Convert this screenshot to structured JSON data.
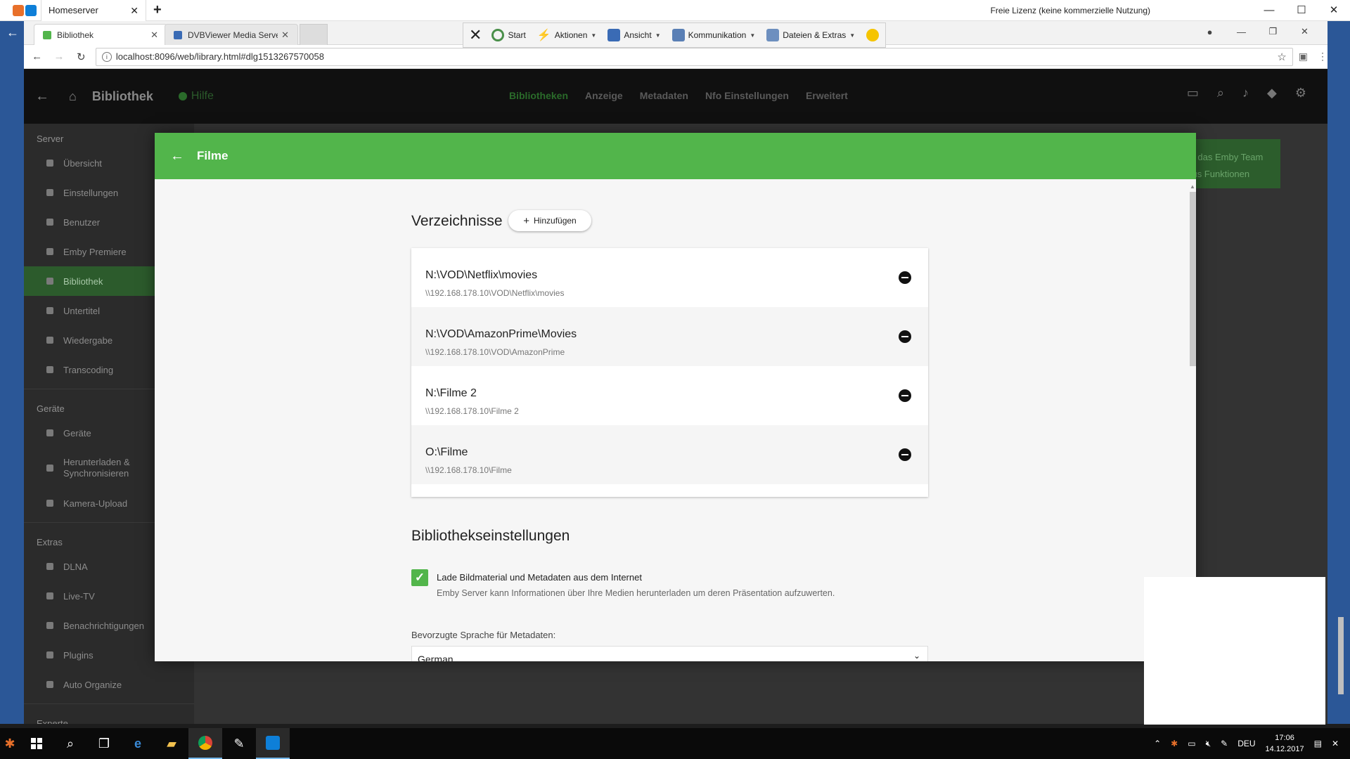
{
  "teamviewer": {
    "tab_title": "Homeserver",
    "license": "Freie Lizenz (keine kommerzielle Nutzung)",
    "toolbar": {
      "start": "Start",
      "aktionen": "Aktionen",
      "ansicht": "Ansicht",
      "kommunikation": "Kommunikation",
      "dateien": "Dateien & Extras"
    }
  },
  "browser": {
    "tabs": [
      {
        "label": "Bibliothek"
      },
      {
        "label": "DVBViewer Media Server"
      }
    ],
    "url": "localhost:8096/web/library.html#dlg1513267570058"
  },
  "emby": {
    "header": {
      "title": "Bibliothek",
      "help": "Hilfe",
      "tabs": [
        "Bibliotheken",
        "Anzeige",
        "Metadaten",
        "Nfo Einstellungen",
        "Erweitert"
      ]
    },
    "sidebar": {
      "sections": [
        {
          "heading": "Server",
          "items": [
            "Übersicht",
            "Einstellungen",
            "Benutzer",
            "Emby Premiere",
            "Bibliothek",
            "Untertitel",
            "Wiedergabe",
            "Transcoding"
          ]
        },
        {
          "heading": "Geräte",
          "items": [
            "Geräte",
            "Herunterladen & Synchronisieren",
            "Kamera-Upload"
          ]
        },
        {
          "heading": "Extras",
          "items": [
            "DLNA",
            "Live-TV",
            "Benachrichtigungen",
            "Plugins",
            "Auto Organize"
          ]
        },
        {
          "heading": "Experte",
          "items": []
        }
      ]
    },
    "premiere_banner": {
      "line1": "Sie das Emby Team",
      "line2": "onus Funktionen"
    }
  },
  "dialog": {
    "title": "Filme",
    "folders_title": "Verzeichnisse",
    "add_button": "Hinzufügen",
    "folders": [
      {
        "path": "N:\\VOD\\Netflix\\movies",
        "unc": "\\\\192.168.178.10\\VOD\\Netflix\\movies"
      },
      {
        "path": "N:\\VOD\\AmazonPrime\\Movies",
        "unc": "\\\\192.168.178.10\\VOD\\AmazonPrime"
      },
      {
        "path": "N:\\Filme 2",
        "unc": "\\\\192.168.178.10\\Filme 2"
      },
      {
        "path": "O:\\Filme",
        "unc": "\\\\192.168.178.10\\Filme"
      }
    ],
    "settings_title": "Bibliothekseinstellungen",
    "download_checkbox": {
      "label": "Lade Bildmaterial und Metadaten aus dem Internet",
      "checked": true
    },
    "download_desc": "Emby Server kann Informationen über Ihre Medien herunterladen um deren Präsentation aufzuwerten.",
    "language_label": "Bevorzugte Sprache für Metadaten:",
    "language_value": "German"
  },
  "taskbar": {
    "lang": "DEU",
    "time": "17:06",
    "date": "14.12.2017"
  },
  "colors": {
    "accent_green": "#52b54b",
    "teamviewer_blue": "#2b5797"
  }
}
